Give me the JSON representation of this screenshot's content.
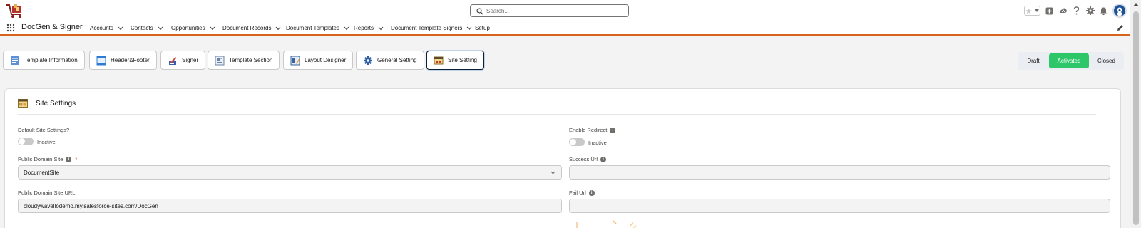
{
  "header": {
    "search_placeholder": "Search...",
    "logo_icon": "cart-logo-icon",
    "icons": [
      "favorite-star-icon",
      "favorites-menu-chevron-icon",
      "global-add-icon",
      "trailhead-icon",
      "help-icon",
      "setup-gear-icon",
      "notifications-bell-icon",
      "user-avatar"
    ]
  },
  "nav": {
    "app_name": "DocGen & Signer",
    "items": [
      {
        "label": "Accounts",
        "has_menu": true
      },
      {
        "label": "Contacts",
        "has_menu": true
      },
      {
        "label": "Opportunities",
        "has_menu": true
      },
      {
        "label": "Document Records",
        "has_menu": true
      },
      {
        "label": "Document Templates",
        "has_menu": true
      },
      {
        "label": "Reports",
        "has_menu": true
      },
      {
        "label": "Document Template Signers",
        "has_menu": true
      },
      {
        "label": "Setup",
        "has_menu": false
      }
    ],
    "accent_color": "#d7641c"
  },
  "tabs": [
    {
      "label": "Template Information",
      "icon": "template-info-icon"
    },
    {
      "label": "Header&Footer",
      "icon": "header-footer-icon"
    },
    {
      "label": "Signer",
      "icon": "signer-icon"
    },
    {
      "label": "Template Section",
      "icon": "template-section-icon"
    },
    {
      "label": "Layout Designer",
      "icon": "layout-designer-icon"
    },
    {
      "label": "General Setting",
      "icon": "general-setting-gear-icon"
    },
    {
      "label": "Site Setting",
      "icon": "site-setting-icon",
      "active": true
    }
  ],
  "status": {
    "options": [
      "Draft",
      "Activated",
      "Closed"
    ],
    "selected": "Activated",
    "selected_color": "#2dc76a"
  },
  "card": {
    "title": "Site Settings",
    "default_site_settings": {
      "label": "Default Site Settings?",
      "state": "Inactive"
    },
    "enable_redirect": {
      "label": "Enable Redirect",
      "state": "Inactive"
    },
    "public_domain_site": {
      "label": "Public Domain Site",
      "required_mark": "*",
      "value": "DocumentSite"
    },
    "success_url": {
      "label": "Success Url",
      "value": ""
    },
    "public_domain_site_url": {
      "label": "Public Domain Site URL",
      "value": "cloudywavellodemo.my.salesforce-sites.com/DocGen"
    },
    "fail_url": {
      "label": "Fail Url",
      "value": ""
    }
  }
}
